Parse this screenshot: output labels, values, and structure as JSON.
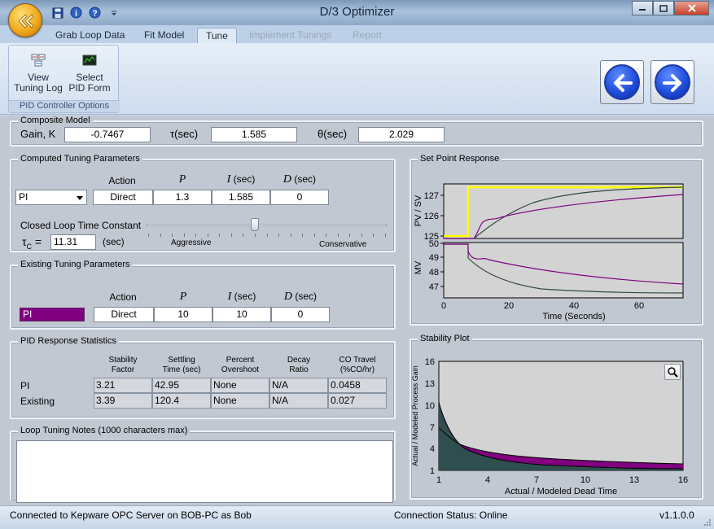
{
  "window": {
    "title": "D/3 Optimizer"
  },
  "ribbon": {
    "tabs": [
      {
        "label": "Grab Loop Data",
        "state": "normal"
      },
      {
        "label": "Fit Model",
        "state": "normal"
      },
      {
        "label": "Tune",
        "state": "active"
      },
      {
        "label": "Implement Tunings",
        "state": "disabled"
      },
      {
        "label": "Report",
        "state": "disabled"
      }
    ],
    "group_label": "PID Controller Options",
    "view_log": {
      "line1": "View",
      "line2": "Tuning Log"
    },
    "select_form": {
      "line1": "Select",
      "line2": "PID Form"
    }
  },
  "composite_model": {
    "title": "Composite Model",
    "gain_label": "Gain, K",
    "gain_value": "-0.7467",
    "tau_symbol": "τ",
    "tau_unit": "(sec)",
    "tau_value": "1.585",
    "theta_symbol": "θ",
    "theta_unit": "(sec)",
    "theta_value": "2.029"
  },
  "computed": {
    "title": "Computed Tuning Parameters",
    "col_action": "Action",
    "col_p": "P",
    "col_i": "I",
    "col_i_unit": "(sec)",
    "col_d": "D",
    "col_d_unit": "(sec)",
    "form": "PI",
    "action": "Direct",
    "p": "1.3",
    "i": "1.585",
    "d": "0",
    "clt_label": "Closed Loop Time Constant",
    "tau_c_symbol": "τ",
    "tau_c_sub": "C",
    "tau_c_eq": "=",
    "tau_c_value": "11.31",
    "tau_c_unit": "(sec)",
    "slider_left": "Aggressive",
    "slider_right": "Conservative",
    "slider_position": 0.45
  },
  "existing": {
    "title": "Existing Tuning Parameters",
    "col_action": "Action",
    "col_p": "P",
    "col_i": "I",
    "col_i_unit": "(sec)",
    "col_d": "D",
    "col_d_unit": "(sec)",
    "form": "PI",
    "form_color": "#800080",
    "action": "Direct",
    "p": "10",
    "i": "10",
    "d": "0"
  },
  "stats": {
    "title": "PID Response Statistics",
    "headers": [
      [
        "Stability",
        "Factor"
      ],
      [
        "Settling",
        "Time (sec)"
      ],
      [
        "Percent",
        "Overshoot"
      ],
      [
        "Decay",
        "Ratio"
      ],
      [
        "CO Travel",
        "(%CO/hr)"
      ]
    ],
    "rows": [
      {
        "label": "PI",
        "values": [
          "3.21",
          "42.95",
          "None",
          "N/A",
          "0.0458"
        ]
      },
      {
        "label": "Existing",
        "values": [
          "3.39",
          "120.4",
          "None",
          "N/A",
          "0.027"
        ]
      }
    ]
  },
  "notes": {
    "title": "Loop Tuning Notes (1000 characters max)",
    "text": ""
  },
  "setpoint_chart": {
    "title": "Set Point Response",
    "pv_label": "PV / SV",
    "mv_label": "MV",
    "xlabel": "Time (Seconds)",
    "x_ticks": [
      "0",
      "20",
      "40",
      "60"
    ],
    "pv_ticks": [
      "127",
      "126",
      "125"
    ],
    "mv_ticks": [
      "50",
      "49",
      "48",
      "47"
    ],
    "colors": {
      "sp": "#ffff00",
      "pi": "#800080",
      "existing": "#2e4a3e"
    }
  },
  "stability_chart": {
    "title": "Stability Plot",
    "xlabel": "Actual / Modeled Dead Time",
    "ylabel": "Actual / Modeled Process Gain",
    "x_ticks": [
      "1",
      "4",
      "7",
      "10",
      "13",
      "16"
    ],
    "y_ticks": [
      "16",
      "13",
      "10",
      "7",
      "4",
      "1"
    ],
    "colors": {
      "pi": "#800080",
      "existing": "#2f4f4f"
    }
  },
  "status": {
    "connection": "Connected to Kepware OPC Server on BOB-PC as Bob",
    "online": "Connection Status: Online",
    "version": "v1.1.0.0"
  }
}
